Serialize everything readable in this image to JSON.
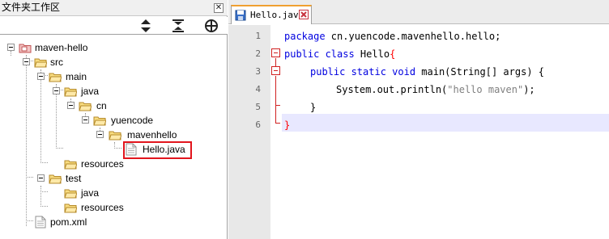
{
  "panel": {
    "title": "文件夹工作区",
    "close_glyph": "✕",
    "toolbar": [
      {
        "name": "collapse-all-icon"
      },
      {
        "name": "expand-all-icon"
      },
      {
        "name": "link-editor-icon"
      }
    ]
  },
  "tree": {
    "maven_hello": "maven-hello",
    "src": "src",
    "main": "main",
    "java": "java",
    "cn": "cn",
    "yuencode": "yuencode",
    "mavenhello": "mavenhello",
    "hello_java": "Hello.java",
    "resources": "resources",
    "test": "test",
    "test_java": "java",
    "test_resources": "resources",
    "pom": "pom.xml"
  },
  "editor": {
    "tab_label": "Hello.java",
    "line_numbers": [
      "1",
      "2",
      "3",
      "4",
      "5",
      "6"
    ],
    "code": {
      "l1_kw": "package",
      "l1_rest": " cn.yuencode.mavenhello.hello;",
      "l2_kw": "public class",
      "l2_name": " Hello",
      "l2_brace": "{",
      "l3_kw": "public static void",
      "l3_rest": " main(String[] args) {",
      "l4_pre": "System.out.println(",
      "l4_str": "\"hello maven\"",
      "l4_post": ");",
      "l5": "}",
      "l6": "}"
    }
  },
  "colors": {
    "keyword": "#0000e0",
    "string": "#808080",
    "highlight_box": "#e2151d",
    "fold_marker": "#d02020",
    "current_line": "#e8e8ff"
  }
}
